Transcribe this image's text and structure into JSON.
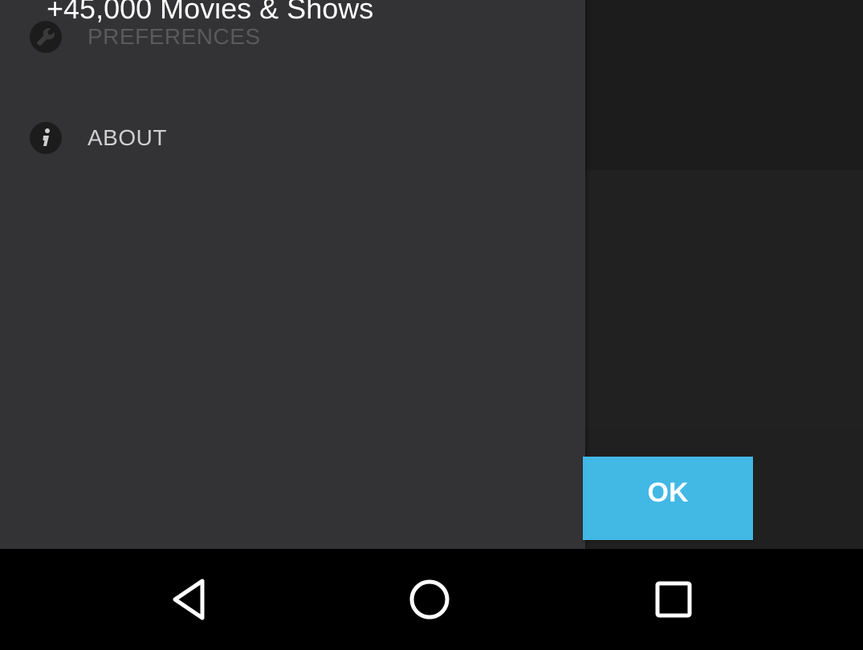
{
  "headline": "+45,000 Movies & Shows",
  "drawer": {
    "items": [
      {
        "label": "PREFERENCES",
        "icon": "wrench-icon"
      },
      {
        "label": "ABOUT",
        "icon": "info-icon"
      }
    ]
  },
  "dialog": {
    "ok_label": "OK"
  },
  "nav_bar": {
    "back_icon": "back-triangle-icon",
    "home_icon": "home-circle-icon",
    "recents_icon": "recents-square-icon"
  },
  "colors": {
    "drawer_bg": "#333335",
    "accent": "#42b8e4",
    "nav_bar_bg": "#000000",
    "backdrop": "#1e1e1e"
  }
}
